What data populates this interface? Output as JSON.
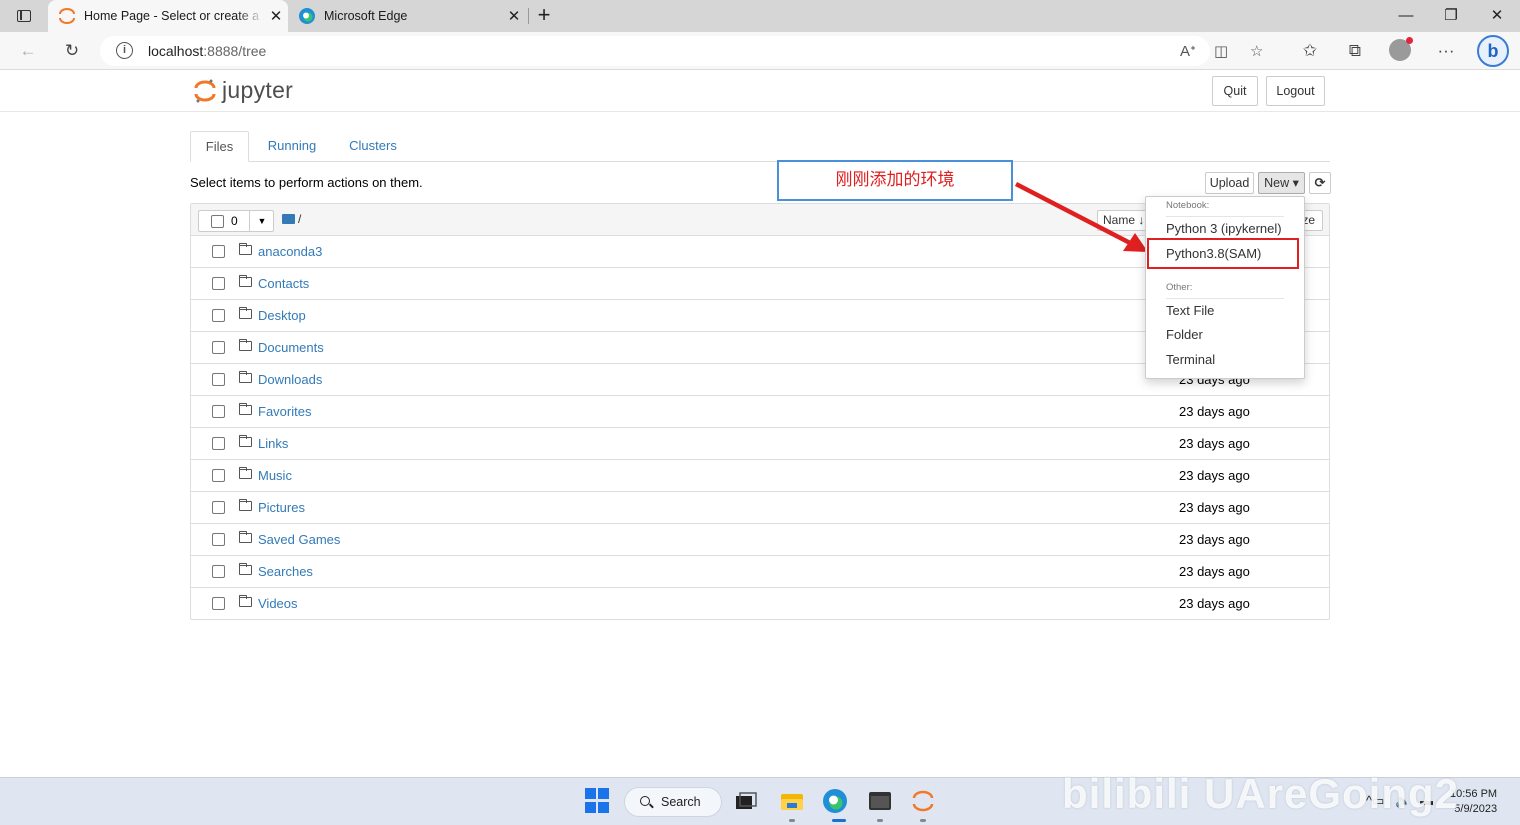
{
  "browser": {
    "tabs": [
      {
        "title": "Home Page - Select or create a n",
        "active": true
      },
      {
        "title": "Microsoft Edge",
        "active": false
      }
    ],
    "url_host": "localhost",
    "url_path": ":8888/tree",
    "new_tab_label": "+",
    "close_symbol": "✕"
  },
  "jupyter": {
    "logo_text": "jupyter",
    "quit_label": "Quit",
    "logout_label": "Logout",
    "tabs": [
      "Files",
      "Running",
      "Clusters"
    ],
    "hint": "Select items to perform actions on them.",
    "upload_label": "Upload",
    "new_label": "New ▾",
    "refresh_label": "⟳",
    "selected_count": "0",
    "breadcrumb": "/",
    "sort_name_label": "Name ↓",
    "sort_size_label": "ze",
    "files": [
      {
        "name": "anaconda3",
        "modified": ""
      },
      {
        "name": "Contacts",
        "modified": ""
      },
      {
        "name": "Desktop",
        "modified": ""
      },
      {
        "name": "Documents",
        "modified": ""
      },
      {
        "name": "Downloads",
        "modified": "23 days ago"
      },
      {
        "name": "Favorites",
        "modified": "23 days ago"
      },
      {
        "name": "Links",
        "modified": "23 days ago"
      },
      {
        "name": "Music",
        "modified": "23 days ago"
      },
      {
        "name": "Pictures",
        "modified": "23 days ago"
      },
      {
        "name": "Saved Games",
        "modified": "23 days ago"
      },
      {
        "name": "Searches",
        "modified": "23 days ago"
      },
      {
        "name": "Videos",
        "modified": "23 days ago"
      }
    ]
  },
  "new_menu": {
    "notebook_header": "Notebook:",
    "notebook_items": [
      "Python 3 (ipykernel)",
      "Python3.8(SAM)"
    ],
    "other_header": "Other:",
    "other_items": [
      "Text File",
      "Folder",
      "Terminal"
    ]
  },
  "annotation": {
    "text": "刚刚添加的环境",
    "color": "#e02020"
  },
  "taskbar": {
    "search_label": "Search",
    "time": "10:56 PM",
    "date": "5/9/2023",
    "watermark": "bilibili UAreGoing2"
  },
  "colors": {
    "link": "#337ab7",
    "jupyter_orange": "#f37726",
    "annotation_red": "#e02020",
    "annotation_border": "#4a90d9"
  }
}
